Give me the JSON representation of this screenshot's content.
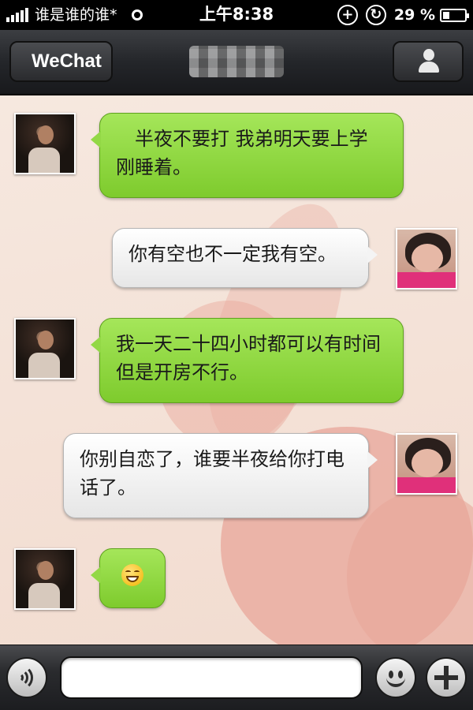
{
  "status_bar": {
    "carrier": "谁是谁的谁*",
    "time": "上午8:38",
    "battery_percent": "29 %",
    "battery_level": 0.29,
    "icons": [
      "signal-icon",
      "activity-icon",
      "location-icon",
      "rotation-lock-icon",
      "battery-icon"
    ]
  },
  "nav": {
    "back_label": "WeChat",
    "title": "",
    "profile_icon": "person-icon"
  },
  "messages": [
    {
      "sender": "contact",
      "side": "left",
      "text": "　半夜不要打 我弟明天要上学　刚睡着。"
    },
    {
      "sender": "me",
      "side": "right",
      "text": "你有空也不一定我有空。"
    },
    {
      "sender": "contact",
      "side": "left",
      "text": "我一天二十四小时都可以有时间　但是开房不行。"
    },
    {
      "sender": "me",
      "side": "right",
      "text": "你别自恋了，谁要半夜给你打电话了。"
    },
    {
      "sender": "contact",
      "side": "left",
      "emoji": "grinning-emoji"
    }
  ],
  "input_bar": {
    "voice_icon": "voice-icon",
    "input_value": "",
    "emoji_icon": "smiley-icon",
    "more_icon": "plus-icon"
  },
  "colors": {
    "bubble_green": "#8fd544",
    "bubble_white": "#f4f4f4",
    "chat_background": "#f3e1d6",
    "heart": "#e8a69a"
  }
}
